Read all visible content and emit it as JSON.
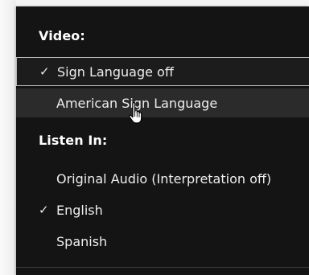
{
  "menu": {
    "video_header": "Video:",
    "video_items": [
      {
        "label": "Sign Language off",
        "checked": true
      },
      {
        "label": "American Sign Language",
        "checked": false
      }
    ],
    "listen_header": "Listen In:",
    "listen_items": [
      {
        "label": "Original Audio (Interpretation off)",
        "checked": false
      },
      {
        "label": "English",
        "checked": true
      },
      {
        "label": "Spanish",
        "checked": false
      }
    ],
    "check_glyph": "✓"
  },
  "icons": {
    "cursor": "hand-pointer-icon"
  }
}
